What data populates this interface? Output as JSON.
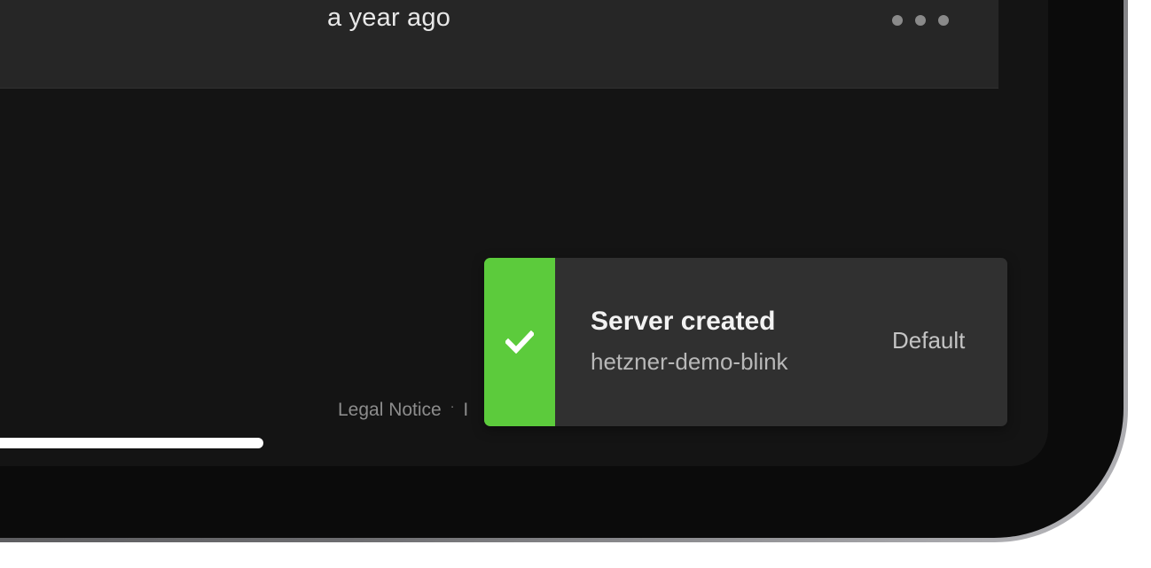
{
  "server_row": {
    "created_relative": "a year ago",
    "menu_icon": "more-horizontal-icon"
  },
  "footer": {
    "legal_notice_label": "Legal Notice",
    "separator": "·",
    "next_link_partial": "I"
  },
  "toast": {
    "status": "success",
    "icon": "checkmark-icon",
    "title": "Server created",
    "subtitle": "hetzner-demo-blink",
    "action_label": "Default"
  },
  "colors": {
    "success_accent": "#5ccb3c",
    "toast_background": "#303030",
    "page_background": "#141414",
    "row_background": "#262626"
  }
}
